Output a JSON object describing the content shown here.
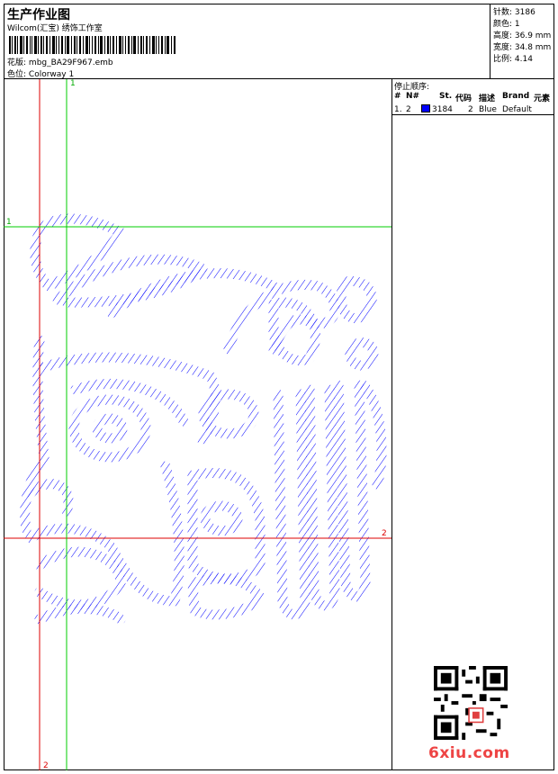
{
  "header": {
    "title": "生产作业图",
    "company": "Wilcom(汇宝) 绣饰工作室",
    "design_label": "花版:",
    "design_value": "mbg_BA29F967.emb",
    "colorway_label": "色位:",
    "colorway_value": "Colorway 1"
  },
  "stats": {
    "stitches": "针数: 3186",
    "colors": "颜色: 1",
    "height": "高度: 36.9 mm",
    "width": "宽度: 34.8 mm",
    "ratio": "比例: 4.14"
  },
  "stop_sequence": {
    "title": "停止顺序:",
    "headers": [
      "#",
      "N#",
      "St.",
      "代码",
      "描述",
      "Brand",
      "元素"
    ],
    "rows": [
      {
        "idx": "1.",
        "needle": "2",
        "stitches": "3184",
        "code": "2",
        "desc": "Blue",
        "brand": "Default",
        "element": ""
      }
    ],
    "swatch_color": "#0000ff"
  },
  "guides": {
    "v1_label_top": "1",
    "v2_label_bottom": "2",
    "h1_label": "1",
    "h2_label": "2",
    "green_color": "#00cc00",
    "red_color": "#dd0000"
  },
  "embroidery": {
    "stitch_color": "#0000ff",
    "description": "stitched design"
  },
  "watermark": "6xiu.com"
}
